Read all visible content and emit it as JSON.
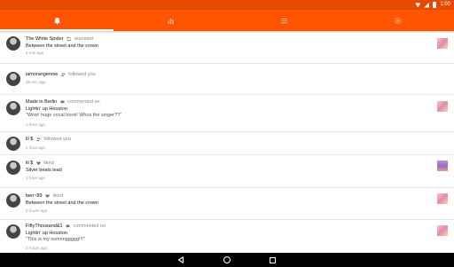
{
  "status_bar": {
    "time": "1:00",
    "background": "#e64a00"
  },
  "tab_bar": {
    "background": "#ff5500",
    "tabs": [
      {
        "name": "activity",
        "icon": "bell-icon",
        "selected": true
      },
      {
        "name": "stats",
        "icon": "bar-chart-icon",
        "selected": false
      },
      {
        "name": "list",
        "icon": "list-icon",
        "selected": false
      },
      {
        "name": "settings",
        "icon": "gear-icon",
        "selected": false
      }
    ]
  },
  "feed": {
    "items": [
      {
        "user": "The White Spider",
        "action_icon": "repost-icon",
        "action": "reposted",
        "track": "Between the street and the crown",
        "comment": "",
        "time": "4 min ago",
        "has_thumb": true
      },
      {
        "user": "iamorangenow",
        "action_icon": "follow-icon",
        "action": "followed you",
        "track": "",
        "comment": "",
        "time": "26 min ago",
        "has_thumb": false
      },
      {
        "user": "Made in Berlin",
        "action_icon": "comment-icon",
        "action": "commented on",
        "track": "Lightin' up Houston",
        "comment": "\"Wow! huge vocal hook! Whos the singer??\"",
        "time": "1 hour ago",
        "has_thumb": true
      },
      {
        "user": "lil $",
        "action_icon": "follow-icon",
        "action": "followed you",
        "track": "",
        "comment": "",
        "time": "1 hour ago",
        "has_thumb": false
      },
      {
        "user": "lil $",
        "action_icon": "heart-icon",
        "action": "liked",
        "track": "Silver beats lead",
        "comment": "",
        "time": "1 hour ago",
        "has_thumb": true
      },
      {
        "user": "ben~89",
        "action_icon": "heart-icon",
        "action": "liked",
        "track": "Between the street and the crown",
        "comment": "",
        "time": "2 hours ago",
        "has_thumb": true
      },
      {
        "user": "FiftyThousand&1",
        "action_icon": "comment-icon",
        "action": "commented on",
        "track": "Lightin' up Houston",
        "comment": "\"This is my somnnggggg!!!\"",
        "time": "2 hours ago",
        "has_thumb": true
      }
    ]
  },
  "nav_bar": {
    "buttons": [
      "back",
      "home",
      "recents"
    ]
  }
}
